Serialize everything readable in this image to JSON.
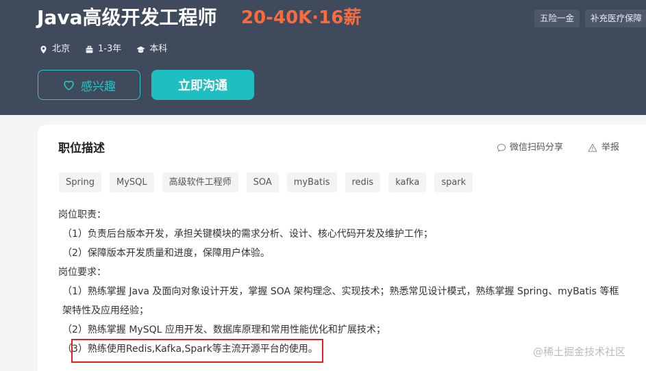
{
  "header": {
    "title": "Java高级开发工程师",
    "salary": "20-40K·16薪",
    "benefits": [
      "五险一金",
      "补充医疗保障"
    ],
    "meta": [
      {
        "icon": "location-icon",
        "text": "北京"
      },
      {
        "icon": "briefcase-icon",
        "text": "1-3年"
      },
      {
        "icon": "graduation-cap-icon",
        "text": "本科"
      }
    ],
    "interest_label": "感兴趣",
    "chat_label": "立即沟通"
  },
  "description": {
    "title": "职位描述",
    "share_label": "微信扫码分享",
    "report_label": "举报",
    "tags": [
      "Spring",
      "MySQL",
      "高级软件工程师",
      "SOA",
      "myBatis",
      "redis",
      "kafka",
      "spark"
    ],
    "lines": [
      "岗位职责：",
      "（1）负责后台版本开发，承担关键模块的需求分析、设计、核心代码开发及维护工作；",
      "（2）保障版本开发质量和进度，保障用户体验。",
      "岗位要求：",
      "（1）熟练掌握 Java 及面向对象设计开发，掌握 SOA 架构理念、实现技术；熟悉常见设计模式，熟练掌握 Spring、myBatis 等框架特性及应用经验；",
      "（2）熟练掌握 MySQL 应用开发、数据库原理和常用性能优化和扩展技术；",
      "（3）熟练使用Redis,Kafka,Spark等主流开源平台的使用。"
    ]
  },
  "watermark": "@稀土掘金技术社区",
  "colors": {
    "header_bg": "#3f4a5c",
    "salary": "#ff6a3d",
    "accent": "#1fbfc1",
    "highlight": "#e62020"
  }
}
